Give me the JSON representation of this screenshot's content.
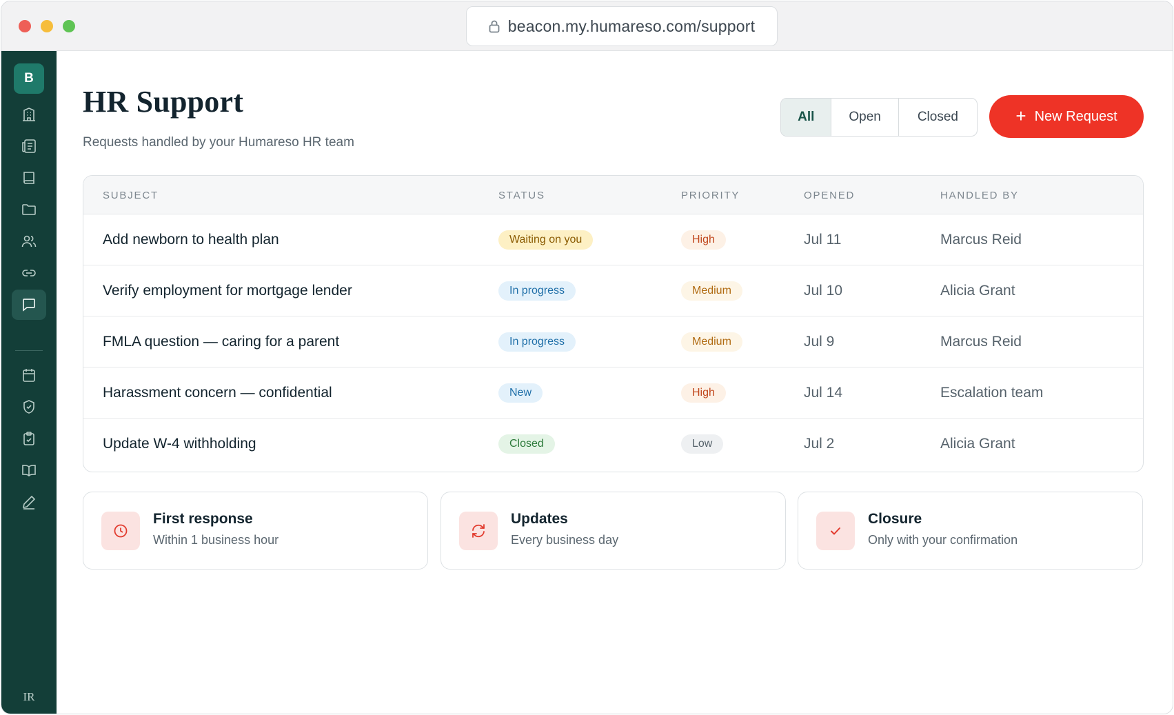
{
  "browser": {
    "url": "beacon.my.humareso.com/support"
  },
  "sidebar": {
    "brand_letter": "B",
    "footer_mark": "IR",
    "nav_icons": [
      "building-icon",
      "newspaper-icon",
      "book-icon",
      "folder-icon",
      "users-icon",
      "link-icon",
      "chat-icon",
      "calendar-icon",
      "shield-icon",
      "clipboard-check-icon",
      "open-book-icon",
      "pen-icon"
    ],
    "active_item": "chat-icon"
  },
  "header": {
    "title": "HR Support",
    "subtitle": "Requests handled by your Humareso HR team"
  },
  "filters": {
    "options": [
      "All",
      "Open",
      "Closed"
    ],
    "selected": "All"
  },
  "new_request_label": "New Request",
  "table": {
    "columns": [
      "SUBJECT",
      "STATUS",
      "PRIORITY",
      "OPENED",
      "HANDLED BY"
    ],
    "rows": [
      {
        "subject": "Add newborn to health plan",
        "status": "Waiting on you",
        "priority": "High",
        "opened": "Jul 11",
        "handled_by": "Marcus Reid"
      },
      {
        "subject": "Verify employment for mortgage lender",
        "status": "In progress",
        "priority": "Medium",
        "opened": "Jul 10",
        "handled_by": "Alicia Grant"
      },
      {
        "subject": "FMLA question — caring for a parent",
        "status": "In progress",
        "priority": "Medium",
        "opened": "Jul 9",
        "handled_by": "Marcus Reid"
      },
      {
        "subject": "Harassment concern — confidential",
        "status": "New",
        "priority": "High",
        "opened": "Jul 14",
        "handled_by": "Escalation team"
      },
      {
        "subject": "Update W-4 withholding",
        "status": "Closed",
        "priority": "Low",
        "opened": "Jul 2",
        "handled_by": "Alicia Grant"
      }
    ]
  },
  "badge_colors": {
    "Waiting on you": {
      "bg": "#fdf0c4",
      "fg": "#8a5a00"
    },
    "In progress": {
      "bg": "#e3f1fb",
      "fg": "#1f6fa8"
    },
    "New": {
      "bg": "#e3f1fb",
      "fg": "#1f6fa8"
    },
    "Closed": {
      "bg": "#e4f4e6",
      "fg": "#2c7a3a"
    },
    "High": {
      "bg": "#fdf1e6",
      "fg": "#c0461c"
    },
    "Medium": {
      "bg": "#fdf5e6",
      "fg": "#b06a10"
    },
    "Low": {
      "bg": "#eef0f2",
      "fg": "#55616a"
    }
  },
  "info_cards": [
    {
      "icon": "clock-icon",
      "title": "First response",
      "description": "Within 1 business hour"
    },
    {
      "icon": "refresh-icon",
      "title": "Updates",
      "description": "Every business day"
    },
    {
      "icon": "check-icon",
      "title": "Closure",
      "description": "Only with your confirmation"
    }
  ],
  "colors": {
    "sidebar_bg": "#133e38",
    "accent": "#ee3326",
    "brand": "#1f7a6a"
  }
}
